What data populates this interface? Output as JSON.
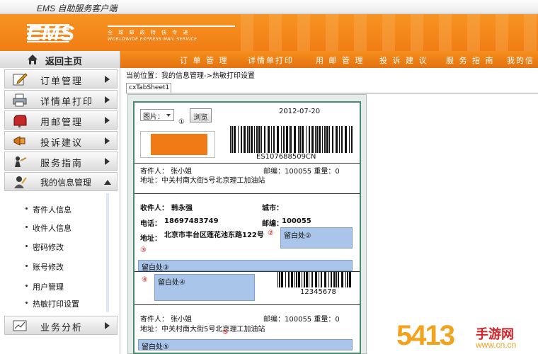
{
  "window": {
    "title": "EMS 自助服务客户端"
  },
  "banner": {
    "logo": "EMS",
    "slogan_cn": "全 球 邮 政 特 快 专 递",
    "slogan_en": "WORLDWIDE EXPRESS MAIL SERVICE"
  },
  "home": {
    "label": "返回主页",
    "icon": "house-icon"
  },
  "topnav": [
    "订 单 管 理",
    "详情单打印",
    "用 邮 管 理",
    "投 诉 建 议",
    "服 务 指 南",
    "我的信息"
  ],
  "sidebar": {
    "menus": [
      {
        "label": "订单管理",
        "icon": "edit-icon"
      },
      {
        "label": "详情单打印",
        "icon": "printer-icon"
      },
      {
        "label": "用邮管理",
        "icon": "mailbox-icon"
      },
      {
        "label": "投诉建议",
        "icon": "megaphone-icon"
      },
      {
        "label": "服务指南",
        "icon": "guide-icon"
      },
      {
        "label": "我的信息管理",
        "icon": "person-icon"
      }
    ],
    "submenu": [
      "寄件人信息",
      "收件人信息",
      "密码修改",
      "账号修改",
      "用户管理",
      "热敏打印设置"
    ],
    "bottom_menu": {
      "label": "业务分析",
      "icon": "chart-icon"
    }
  },
  "breadcrumb": "当前位置：我的信息管理->热敏打印设置",
  "tab": "cxTabSheet1",
  "label_form": {
    "select_value": "图片：",
    "marker1": "①",
    "browse_button": "浏览",
    "date": "2012-07-20",
    "tracking_no": "ES107688509CN",
    "sender_line1_name": "寄件人：  张小姐",
    "sender_line1_postal": "邮编：100055 重量：0",
    "sender_line1_addr": "地址：中关村南大街5号北京理工加油站",
    "receiver_label": "收件人：",
    "receiver_name": "韩永强",
    "city_label": "城市：",
    "phone_label": "电话：",
    "phone": "18697483749",
    "postal_label": "邮编：",
    "postal": "100055",
    "address_label": "地址：",
    "address": "北京市丰台区莲花池东路122号",
    "marker2": "②",
    "blank2": "留白处②",
    "marker3": "③",
    "blank3": "留白处③",
    "marker4": "④",
    "blank4": "留白处④",
    "barcode2_no": "12345678",
    "sender2_name": "寄件人：     张小姐",
    "sender2_postal": "邮编：100055 重量：0",
    "sender2_addr": "地址：中关村南大街5号北京理工加油站",
    "marker5": "⑤",
    "blank5": "留白处⑤"
  },
  "watermark": {
    "big": "5413",
    "cn": "手游网",
    "url": "www.cn.cn"
  },
  "colors": {
    "ems_orange": "#f17d14",
    "placeholder_blue": "#a9c5ea",
    "frame_green": "#4d8a72"
  }
}
